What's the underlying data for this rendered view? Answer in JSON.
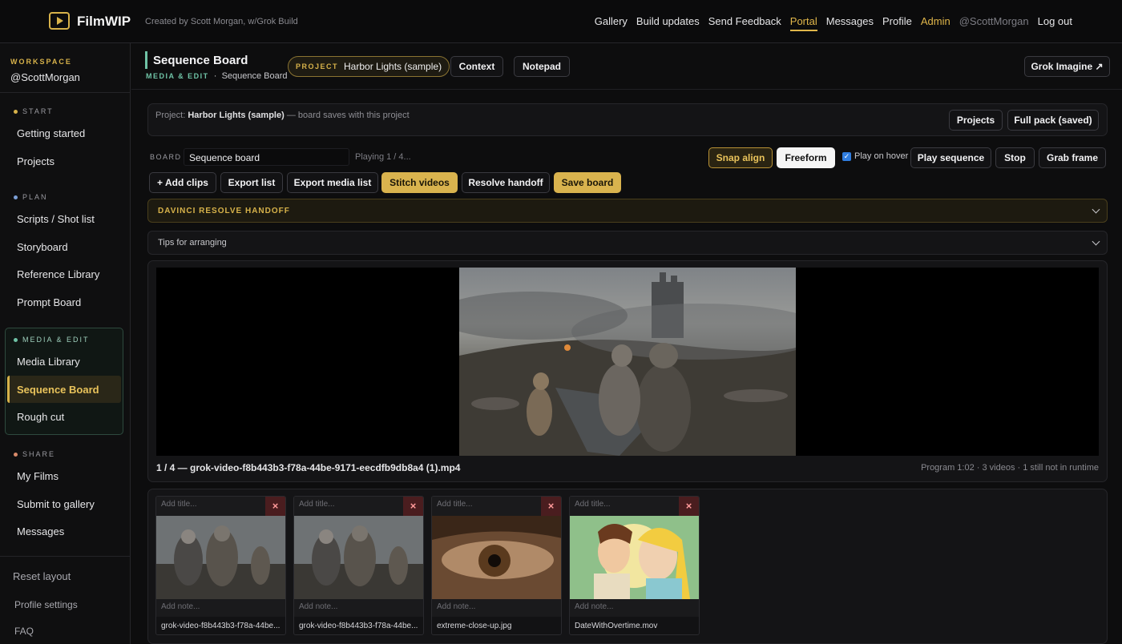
{
  "app": {
    "name": "FilmWIP",
    "created_by": "Created by Scott Morgan, w/Grok Build"
  },
  "nav": {
    "items": [
      "Gallery",
      "Build updates",
      "Send Feedback",
      "Portal",
      "Messages",
      "Profile",
      "Admin",
      "@ScottMorgan",
      "Log out"
    ],
    "active": "Portal"
  },
  "sidebar": {
    "workspace_label": "WORKSPACE",
    "user": "@ScottMorgan",
    "sections": [
      {
        "label": "START",
        "items": [
          "Getting started",
          "Projects"
        ]
      },
      {
        "label": "PLAN",
        "items": [
          "Scripts / Shot list",
          "Storyboard",
          "Reference Library",
          "Prompt Board"
        ]
      },
      {
        "label": "MEDIA & EDIT",
        "items": [
          "Media Library",
          "Sequence Board",
          "Rough cut"
        ]
      },
      {
        "label": "SHARE",
        "items": [
          "My Films",
          "Submit to gallery",
          "Messages"
        ]
      }
    ],
    "selected": "Sequence Board",
    "footer": [
      "Reset layout",
      "Profile settings",
      "FAQ"
    ]
  },
  "header": {
    "title": "Sequence Board",
    "crumb_section": "MEDIA & EDIT",
    "crumb_page": "Sequence Board",
    "project_key": "PROJECT",
    "project_name": "Harbor Lights (sample)",
    "context": "Context",
    "notepad": "Notepad",
    "grok": "Grok Imagine ↗"
  },
  "project_bar": {
    "prefix": "Project:",
    "name": "Harbor Lights (sample)",
    "suffix": "— board saves with this project",
    "projects_btn": "Projects",
    "fullpack_btn": "Full pack (saved)"
  },
  "board": {
    "label": "BOARD",
    "name": "Sequence board",
    "playing": "Playing 1 / 4...",
    "snap": "Snap align",
    "freeform": "Freeform",
    "hover": "Play on hover",
    "hover_checked": true,
    "play": "Play sequence",
    "stop": "Stop",
    "grab": "Grab frame"
  },
  "actions": [
    "+ Add clips",
    "Export list",
    "Export media list",
    "Stitch videos",
    "Resolve handoff",
    "Save board"
  ],
  "accordions": {
    "davinci": "DAVINCI RESOLVE HANDOFF",
    "tips": "Tips for arranging"
  },
  "player": {
    "caption": "1 / 4 — grok-video-f8b443b3-f78a-44be-9171-eecdfb9db8a4 (1).mp4",
    "program": "Program 1:02 · 3 videos · 1 still not in runtime"
  },
  "clips": [
    {
      "title_placeholder": "Add title...",
      "note_placeholder": "Add note...",
      "filename": "grok-video-f8b443b3-f78a-44be...",
      "remove": "×"
    },
    {
      "title_placeholder": "Add title...",
      "note_placeholder": "Add note...",
      "filename": "grok-video-f8b443b3-f78a-44be...",
      "remove": "×"
    },
    {
      "title_placeholder": "Add title...",
      "note_placeholder": "Add note...",
      "filename": "extreme-close-up.jpg",
      "remove": "×"
    },
    {
      "title_placeholder": "Add title...",
      "note_placeholder": "Add note...",
      "filename": "DateWithOvertime.mov",
      "remove": "×"
    }
  ]
}
